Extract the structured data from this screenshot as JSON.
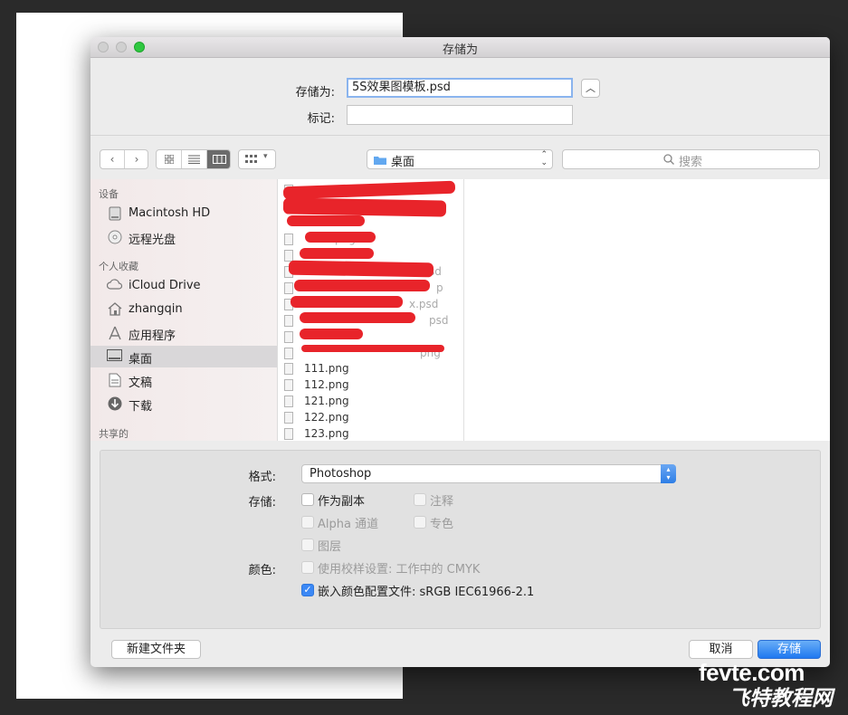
{
  "window": {
    "title": "存储为"
  },
  "form": {
    "save_as_label": "存储为:",
    "save_as_value": "5S效果图模板.psd",
    "tags_label": "标记:",
    "tags_value": ""
  },
  "toolbar": {
    "location": "桌面",
    "search_placeholder": "搜索"
  },
  "sidebar": {
    "sections": [
      {
        "heading": "设备",
        "items": [
          {
            "label": "Macintosh HD",
            "icon": "hard-drive-icon"
          },
          {
            "label": "远程光盘",
            "icon": "disc-icon"
          }
        ]
      },
      {
        "heading": "个人收藏",
        "items": [
          {
            "label": "iCloud Drive",
            "icon": "cloud-icon"
          },
          {
            "label": "zhangqin",
            "icon": "home-icon"
          },
          {
            "label": "应用程序",
            "icon": "applications-icon"
          },
          {
            "label": "桌面",
            "icon": "desktop-icon",
            "selected": true
          },
          {
            "label": "文稿",
            "icon": "documents-icon"
          },
          {
            "label": "下载",
            "icon": "downloads-icon"
          }
        ]
      },
      {
        "heading": "共享的",
        "items": []
      }
    ]
  },
  "files": {
    "redacted_fragments": [
      "png",
      "sd",
      "p",
      "x.psd",
      "psd",
      "png"
    ],
    "visible": [
      "111.png",
      "112.png",
      "121.png",
      "122.png",
      "123.png"
    ]
  },
  "options": {
    "format_label": "格式:",
    "format_value": "Photoshop",
    "save_label": "存储:",
    "color_label": "颜色:",
    "checkboxes": [
      {
        "label": "作为副本",
        "checked": false,
        "disabled": false
      },
      {
        "label": "注释",
        "checked": false,
        "disabled": true
      },
      {
        "label": "Alpha 通道",
        "checked": false,
        "disabled": true
      },
      {
        "label": "专色",
        "checked": false,
        "disabled": true
      },
      {
        "label": "图层",
        "checked": false,
        "disabled": true
      },
      {
        "label": "使用校样设置: 工作中的 CMYK",
        "checked": false,
        "disabled": true
      },
      {
        "label": "嵌入颜色配置文件: sRGB IEC61966-2.1",
        "checked": true,
        "disabled": false
      }
    ]
  },
  "buttons": {
    "new_folder": "新建文件夹",
    "cancel": "取消",
    "save": "存储"
  },
  "watermark": {
    "line1": "fevte.com",
    "line2": "飞特教程网"
  },
  "colors": {
    "accent": "#3b88f5",
    "redaction": "#e8242a"
  }
}
